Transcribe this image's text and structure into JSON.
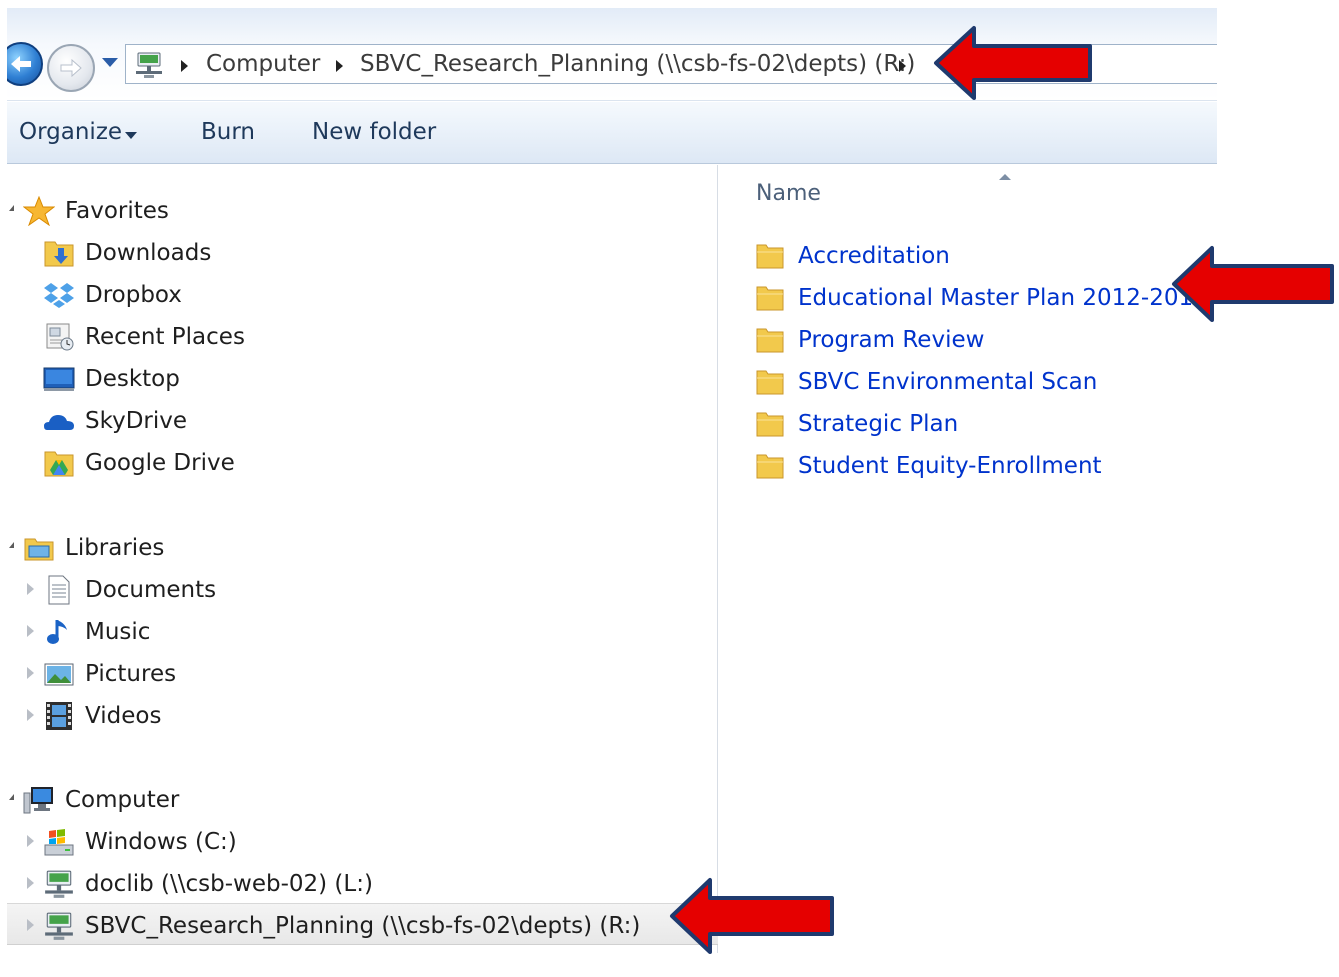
{
  "address_bar": {
    "crumbs": [
      "Computer",
      "SBVC_Research_Planning (\\\\csb-fs-02\\depts) (R:)"
    ]
  },
  "toolbar": {
    "organize_label": "Organize",
    "burn_label": "Burn",
    "new_folder_label": "New folder"
  },
  "nav": {
    "favorites": {
      "label": "Favorites",
      "items": [
        {
          "label": "Downloads",
          "icon": "downloads-icon"
        },
        {
          "label": "Dropbox",
          "icon": "dropbox-icon"
        },
        {
          "label": "Recent Places",
          "icon": "recent-places-icon"
        },
        {
          "label": "Desktop",
          "icon": "desktop-icon"
        },
        {
          "label": "SkyDrive",
          "icon": "skydrive-icon"
        },
        {
          "label": "Google Drive",
          "icon": "google-drive-icon"
        }
      ]
    },
    "libraries": {
      "label": "Libraries",
      "items": [
        {
          "label": "Documents",
          "icon": "documents-icon"
        },
        {
          "label": "Music",
          "icon": "music-icon"
        },
        {
          "label": "Pictures",
          "icon": "pictures-icon"
        },
        {
          "label": "Videos",
          "icon": "videos-icon"
        }
      ]
    },
    "computer": {
      "label": "Computer",
      "items": [
        {
          "label": "Windows (C:)",
          "icon": "windows-drive-icon"
        },
        {
          "label": "doclib (\\\\csb-web-02) (L:)",
          "icon": "network-drive-icon"
        },
        {
          "label": "SBVC_Research_Planning (\\\\csb-fs-02\\depts) (R:)",
          "icon": "network-drive-icon",
          "selected": true
        }
      ]
    }
  },
  "content": {
    "column_header": "Name",
    "folders": [
      "Accreditation",
      "Educational Master Plan 2012-2013",
      "Program Review",
      "SBVC Environmental Scan",
      "Strategic Plan",
      "Student Equity-Enrollment"
    ]
  },
  "colors": {
    "link_blue": "#0033cc",
    "annotation_red": "#e50000",
    "annotation_outline": "#1f3a6e",
    "folder_yellow": "#f2c94c"
  }
}
